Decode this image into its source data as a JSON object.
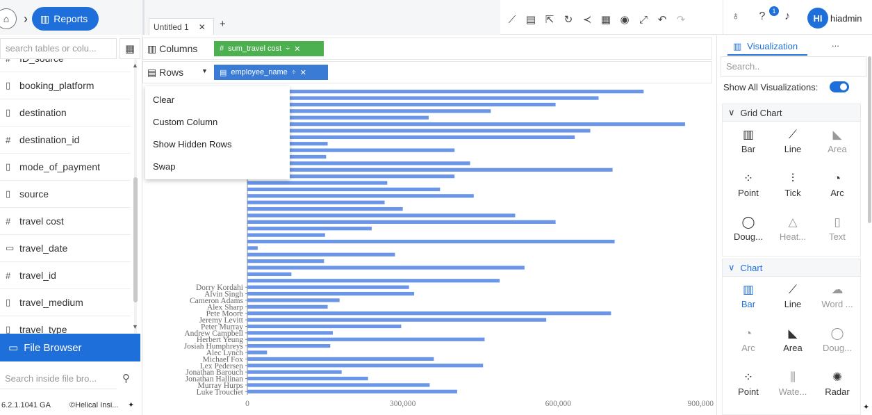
{
  "nav": {
    "home_icon": "home-icon",
    "reports_label": "Reports"
  },
  "tabs": {
    "active": "Untitled 1",
    "add": "+",
    "close": "✕"
  },
  "user": {
    "name": "hiadmin",
    "initials": "HI",
    "notifications": "1"
  },
  "left": {
    "search_placeholder": "search tables or colu...",
    "fields": [
      {
        "type": "#",
        "name": "ID_source"
      },
      {
        "type": "doc",
        "name": "booking_platform"
      },
      {
        "type": "doc",
        "name": "destination"
      },
      {
        "type": "#",
        "name": "destination_id"
      },
      {
        "type": "doc",
        "name": "mode_of_payment"
      },
      {
        "type": "doc",
        "name": "source"
      },
      {
        "type": "#",
        "name": "travel cost"
      },
      {
        "type": "date",
        "name": "travel_date"
      },
      {
        "type": "#",
        "name": "travel_id"
      },
      {
        "type": "doc",
        "name": "travel_medium"
      },
      {
        "type": "doc",
        "name": "travel_type"
      }
    ],
    "file_browser": "File Browser",
    "file_search_placeholder": "Search inside file bro...",
    "version": "6.2.1.1041 GA",
    "copyright": "©Helical Insi..."
  },
  "shelves": {
    "columns_label": "Columns",
    "rows_label": "Rows",
    "column_pill": "sum_travel cost",
    "row_pill": "employee_name"
  },
  "context_menu": [
    "Clear",
    "Custom Column",
    "Show Hidden Rows",
    "Swap"
  ],
  "chart_data": {
    "type": "bar",
    "orientation": "horizontal",
    "xlim": [
      0,
      900000
    ],
    "xticks": [
      0,
      300000,
      600000,
      900000
    ],
    "xtick_labels": [
      "0",
      "300,000",
      "600,000",
      "900,000"
    ],
    "categories": [
      "",
      "",
      "",
      "",
      "",
      "",
      "",
      "",
      "",
      "",
      "",
      "",
      "",
      "",
      "",
      "",
      "",
      "",
      "",
      "",
      "",
      "",
      "",
      "",
      "",
      "",
      "",
      "",
      "",
      "",
      "",
      "",
      "",
      "",
      "",
      "",
      "",
      "",
      "",
      "",
      "",
      "",
      "",
      "",
      "",
      "",
      "",
      "",
      "",
      "",
      "",
      "",
      "",
      "",
      ""
    ],
    "labels_visible": [
      "Dorry Kordahi",
      "Alvin Singh",
      "Cameron Adams",
      "Alex Sharp",
      "Pete Moore",
      "Jeremy Levitt",
      "Peter Murray",
      "Andrew Campbell",
      "Herbert Yeung",
      "Josiah Humphreys",
      "Alec Lynch",
      "Michael Fox",
      "Lex Pedersen",
      "Jonathan Barouch",
      "Jonathan Hallinan",
      "Murray Hurps",
      "Luke Trouchet"
    ],
    "values": [
      765000,
      678000,
      595000,
      470000,
      350000,
      845000,
      662000,
      632000,
      155000,
      400000,
      152000,
      430000,
      705000,
      400000,
      270000,
      372000,
      437000,
      265000,
      300000,
      517000,
      595000,
      240000,
      150000,
      709000,
      20000,
      285000,
      148000,
      535000,
      85000,
      487000,
      312000,
      322000,
      178000,
      155000,
      702000,
      577000,
      297000,
      165000,
      458000,
      160000,
      38000,
      360000,
      455000,
      182000,
      233000,
      352000,
      405000
    ],
    "series_color": "#6b96e8"
  },
  "viz": {
    "tab_label": "Visualization",
    "more": "...",
    "search_placeholder": "Search..",
    "show_all_label": "Show All Visualizations:",
    "grid_section": "Grid Chart",
    "grid_items": [
      {
        "label": "Bar",
        "icon": "bar-chart-icon",
        "dim": false
      },
      {
        "label": "Line",
        "icon": "line-chart-icon",
        "dim": false
      },
      {
        "label": "Area",
        "icon": "area-chart-icon",
        "dim": true
      },
      {
        "label": "Point",
        "icon": "point-chart-icon",
        "dim": false
      },
      {
        "label": "Tick",
        "icon": "tick-chart-icon",
        "dim": false
      },
      {
        "label": "Arc",
        "icon": "arc-chart-icon",
        "dim": false
      },
      {
        "label": "Doug...",
        "icon": "doughnut-chart-icon",
        "dim": false
      },
      {
        "label": "Heat...",
        "icon": "heatmap-icon",
        "dim": true
      },
      {
        "label": "Text",
        "icon": "text-chart-icon",
        "dim": true
      }
    ],
    "chart_section": "Chart",
    "chart_items": [
      {
        "label": "Bar",
        "icon": "bar-chart-icon",
        "sel": true
      },
      {
        "label": "Line",
        "icon": "line-chart-icon",
        "sel": false
      },
      {
        "label": "Word ...",
        "icon": "word-cloud-icon",
        "dim": true
      },
      {
        "label": "Arc",
        "icon": "arc-chart-icon",
        "dim": true
      },
      {
        "label": "Area",
        "icon": "area-chart-icon",
        "sel": false
      },
      {
        "label": "Doug...",
        "icon": "doughnut-chart-icon",
        "dim": true
      },
      {
        "label": "Point",
        "icon": "point-chart-icon",
        "sel": false
      },
      {
        "label": "Wate...",
        "icon": "waterfall-chart-icon",
        "dim": true
      },
      {
        "label": "Radar",
        "icon": "radar-chart-icon",
        "sel": false
      }
    ]
  }
}
